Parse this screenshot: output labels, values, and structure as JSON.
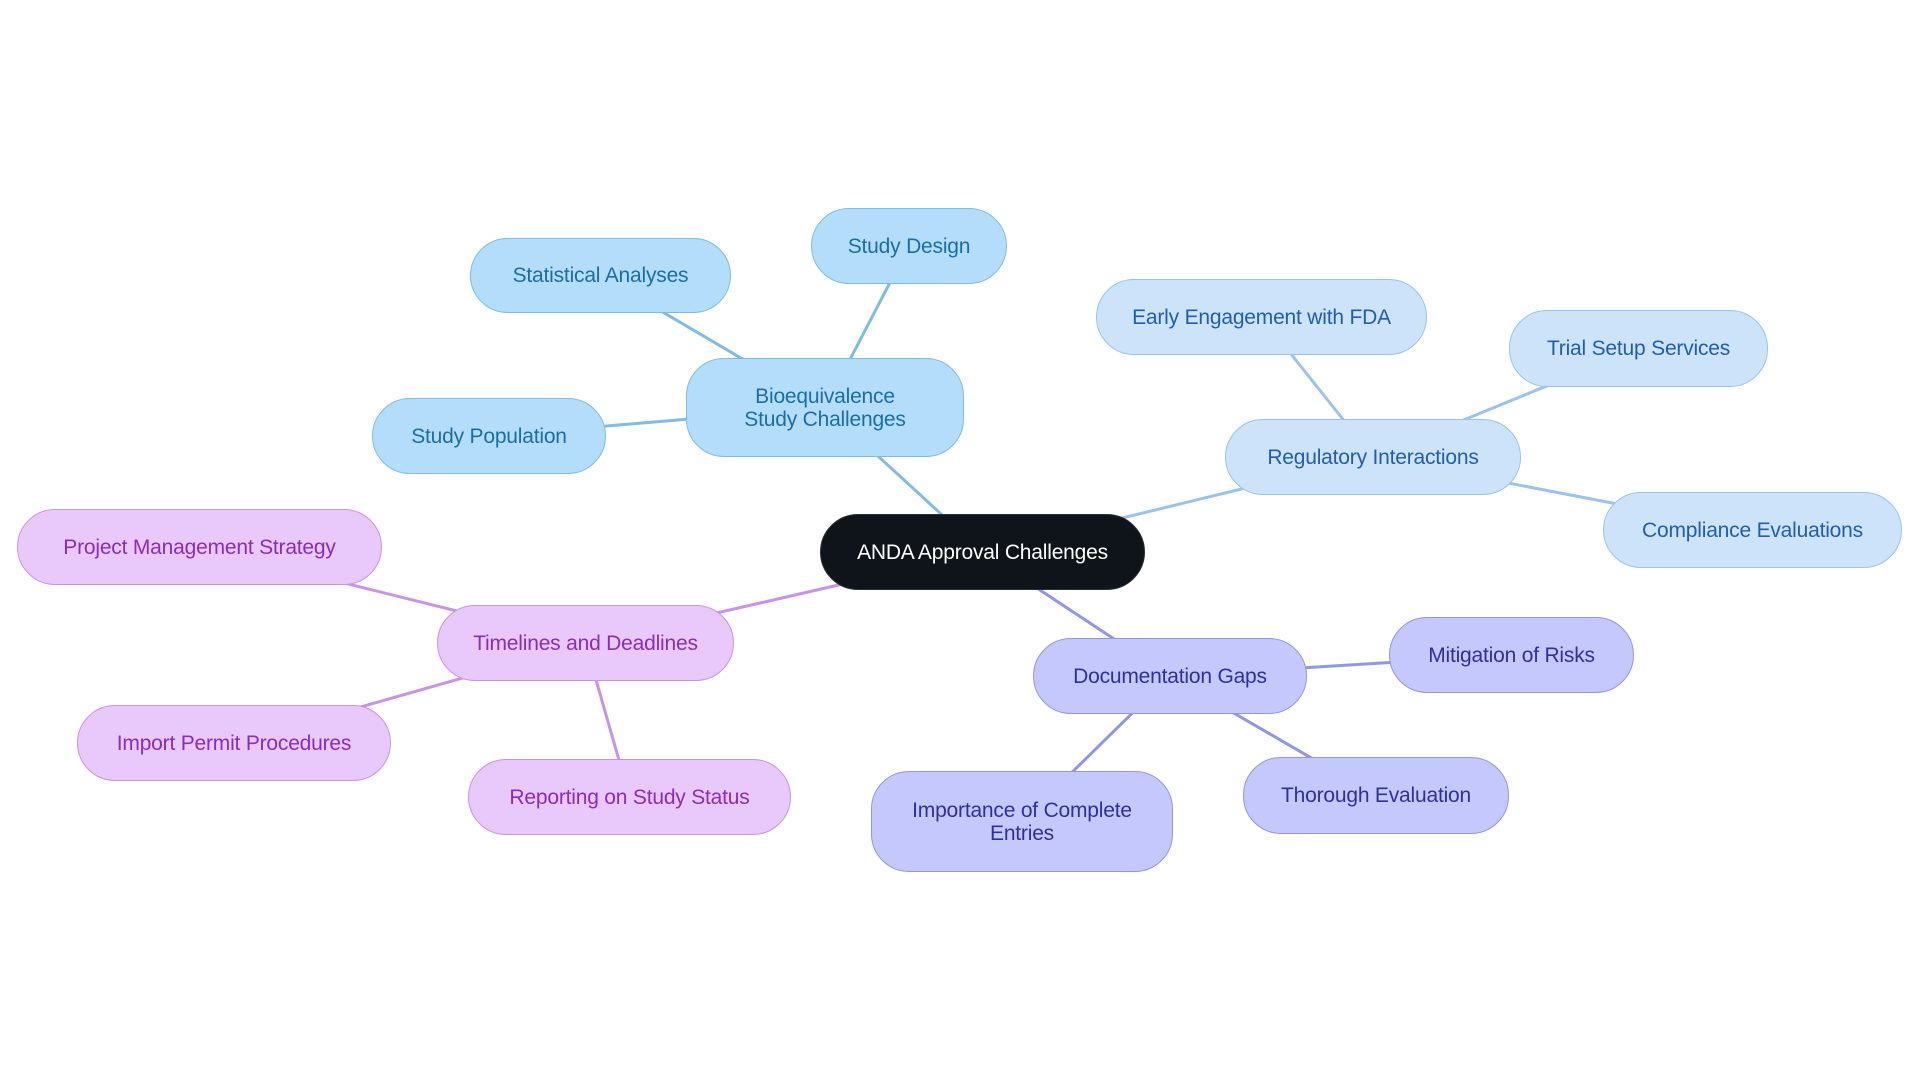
{
  "diagram": {
    "type": "mindmap",
    "root": {
      "id": "root",
      "label": "ANDA Approval Challenges"
    },
    "branches": [
      {
        "id": "bio",
        "label": "Bioequivalence Study Challenges",
        "color": "#7fbde6",
        "children": [
          {
            "id": "bio-stat",
            "label": "Statistical Analyses"
          },
          {
            "id": "bio-design",
            "label": "Study Design"
          },
          {
            "id": "bio-pop",
            "label": "Study Population"
          }
        ]
      },
      {
        "id": "reg",
        "label": "Regulatory Interactions",
        "color": "#9ac4ee",
        "children": [
          {
            "id": "reg-early",
            "label": "Early Engagement with FDA"
          },
          {
            "id": "reg-trial",
            "label": "Trial Setup Services"
          },
          {
            "id": "reg-comp",
            "label": "Compliance Evaluations"
          }
        ]
      },
      {
        "id": "time",
        "label": "Timelines and Deadlines",
        "color": "#c993ea",
        "children": [
          {
            "id": "time-pm",
            "label": "Project Management Strategy"
          },
          {
            "id": "time-import",
            "label": "Import Permit Procedures"
          },
          {
            "id": "time-report",
            "label": "Reporting on Study Status"
          }
        ]
      },
      {
        "id": "doc",
        "label": "Documentation Gaps",
        "color": "#9296e6",
        "children": [
          {
            "id": "doc-mit",
            "label": "Mitigation of Risks"
          },
          {
            "id": "doc-imp",
            "label": "Importance of Complete Entries"
          },
          {
            "id": "doc-thor",
            "label": "Thorough Evaluation"
          }
        ]
      }
    ]
  }
}
